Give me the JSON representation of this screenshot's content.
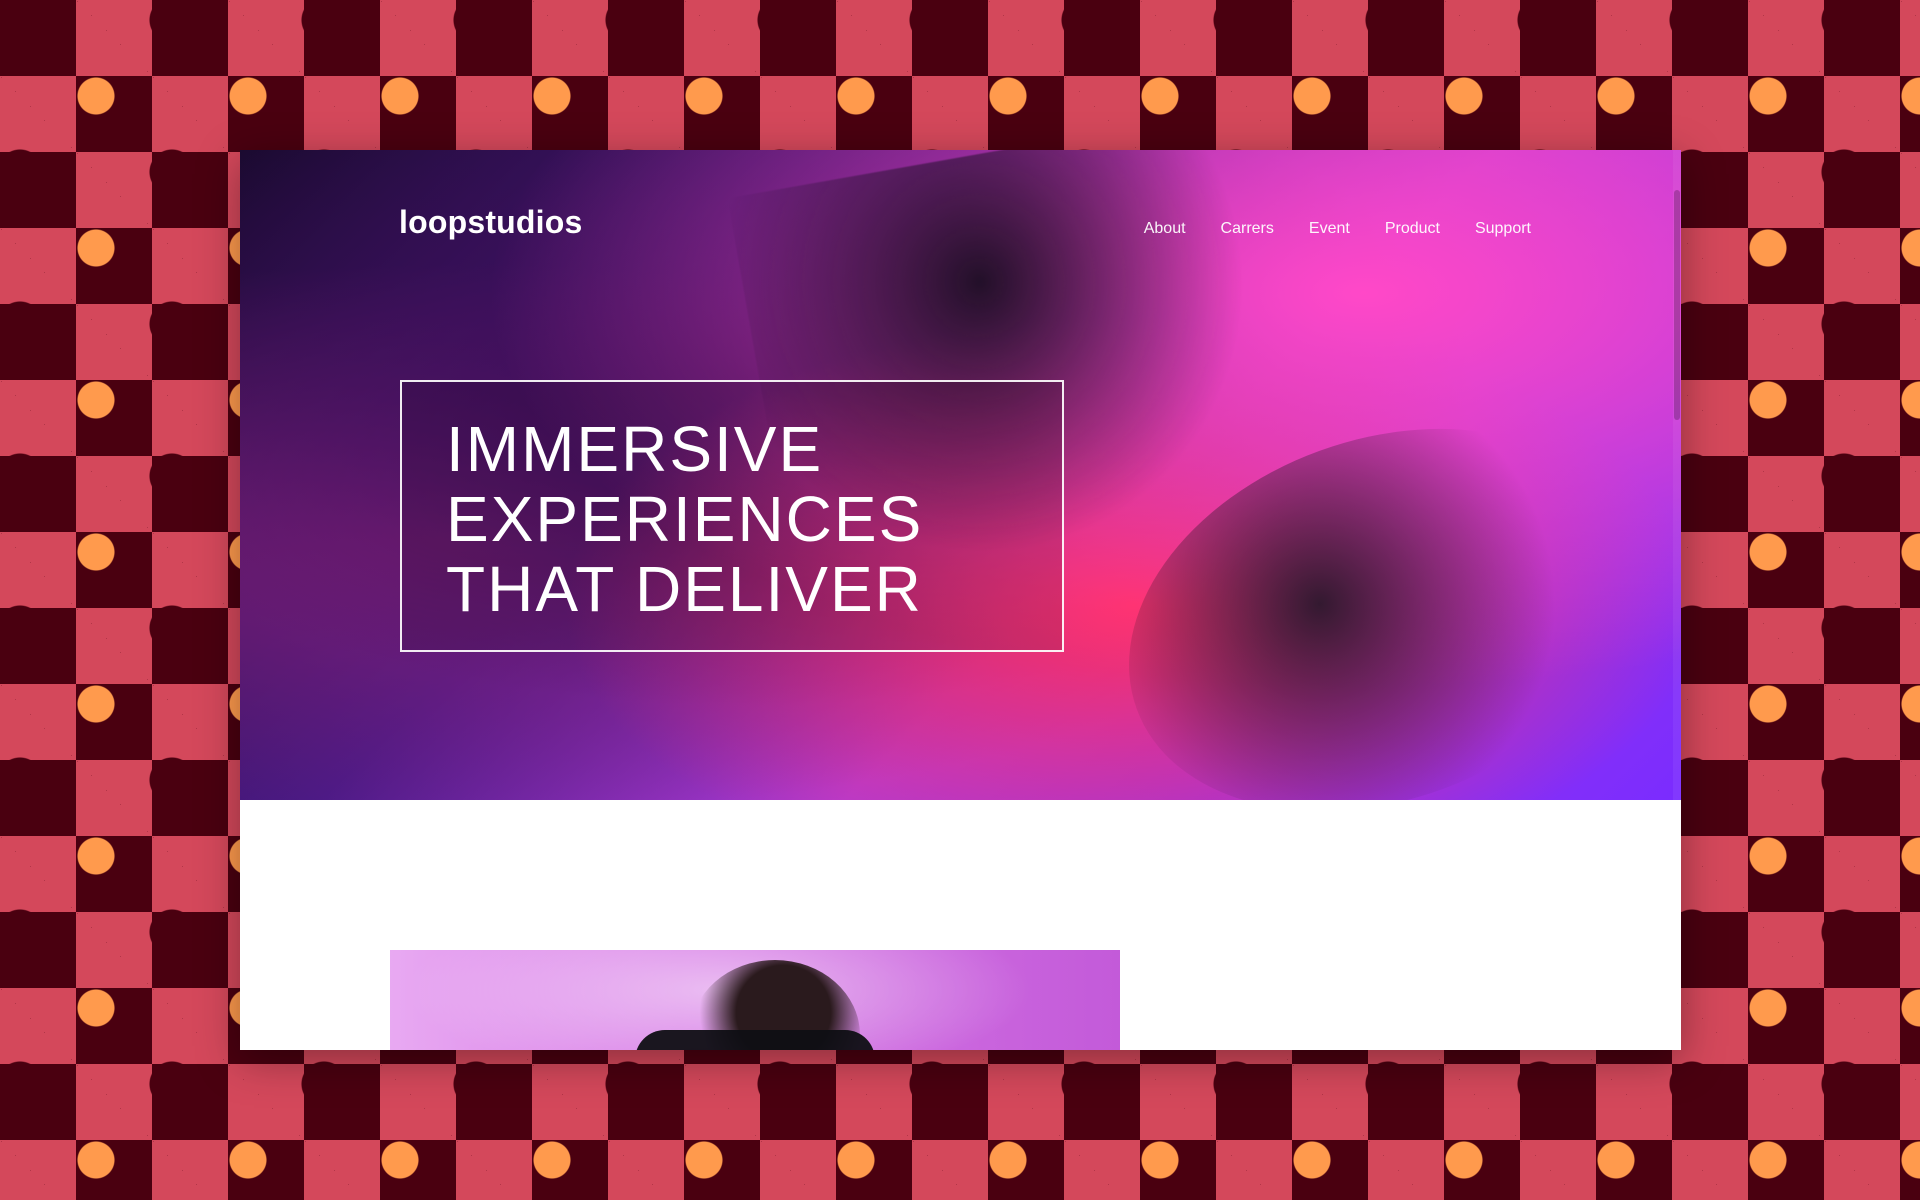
{
  "site": {
    "brand": "loopstudios",
    "nav": [
      "About",
      "Carrers",
      "Event",
      "Product",
      "Support"
    ],
    "hero": {
      "headline_lines": [
        "IMMERSIVE",
        "EXPERIENCES",
        "THAT DELIVER"
      ]
    }
  },
  "colors": {
    "backdrop_dark": "#4a0010",
    "backdrop_tile": "#d4485b",
    "backdrop_dot": "#ff9a4d",
    "page_bg": "#ffffff",
    "text_light": "#ffffff"
  }
}
